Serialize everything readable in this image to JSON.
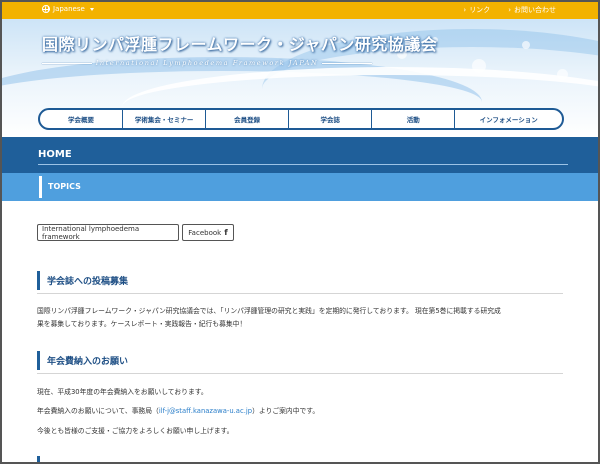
{
  "topbar": {
    "language": "Japanese",
    "links": [
      {
        "label": "リンク"
      },
      {
        "label": "お問い合わせ"
      }
    ]
  },
  "header": {
    "title": "国際リンパ浮腫フレームワーク・ジャパン研究協議会",
    "subtitle": "International Lymphoedema Framework JAPAN"
  },
  "nav": {
    "items": [
      {
        "label": "学会概要"
      },
      {
        "label": "学術集会・セミナー"
      },
      {
        "label": "会員登録"
      },
      {
        "label": "学会誌"
      },
      {
        "label": "活動"
      },
      {
        "label": "インフォメーション"
      }
    ]
  },
  "home": {
    "title": "HOME"
  },
  "topics": {
    "title": "TOPICS"
  },
  "buttons": {
    "ilf": "International lymphoedema framework",
    "facebook": "Facebook"
  },
  "sections": [
    {
      "heading": "学会誌への投稿募集",
      "lines": [
        "国際リンパ浮腫フレームワーク・ジャパン研究協議会では、「リンパ浮腫管理の研究と実践」を定期的に発行しております。 現在第5巻に掲載する研究成",
        "果を募集しております。ケースレポート・実践報告・紀行も募集中！"
      ]
    },
    {
      "heading": "年会費納入のお願い",
      "line1": "現在、平成30年度の年会費納入をお願いしております。",
      "line2_before": "年会費納入のお願いについて、事務局（",
      "email": "ilf-j@staff.kanazawa-u.ac.jp",
      "line2_after": "）よりご案内中です。",
      "line3": "今後とも皆様のご支援・ご協力をよろしくお願い申し上げます。"
    }
  ]
}
